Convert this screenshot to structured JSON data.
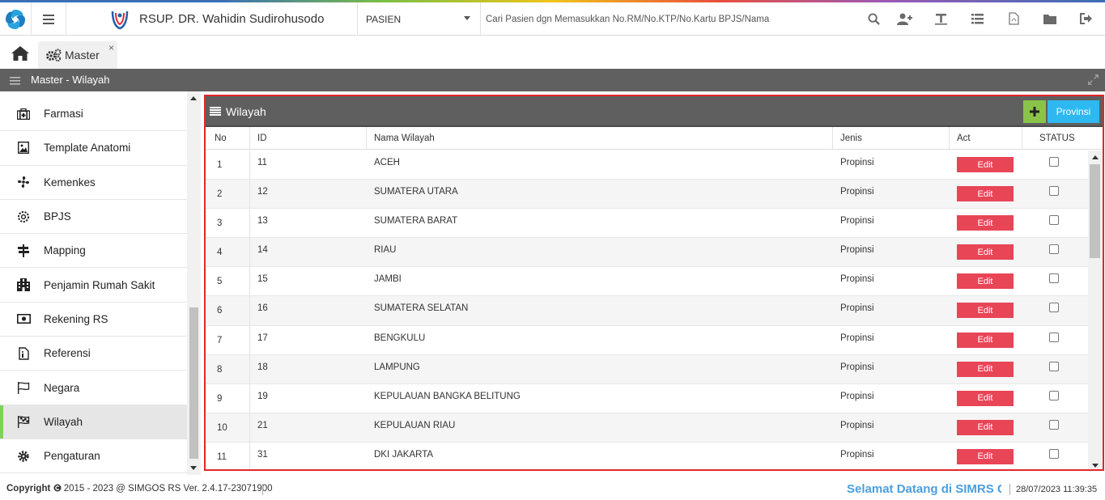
{
  "header": {
    "hospital_name": "RSUP. DR. Wahidin Sudirohusodo",
    "patient_select": "PASIEN",
    "search_placeholder": "Cari Pasien dgn Memasukkan No.RM/No.KTP/No.Kartu BPJS/Nama",
    "icons": [
      "search-icon",
      "add-user-icon",
      "text-icon",
      "list-icon",
      "pdf-icon",
      "folder-icon",
      "logout-icon"
    ]
  },
  "tabs": [
    {
      "label": "Master",
      "icon": "gears-icon",
      "close": "×"
    }
  ],
  "titlebar": {
    "title": "Master - Wilayah"
  },
  "sidebar": {
    "items": [
      {
        "label": "Farmasi",
        "icon": "medkit-icon",
        "active": false
      },
      {
        "label": "Template Anatomi",
        "icon": "image-icon",
        "active": false
      },
      {
        "label": "Kemenkes",
        "icon": "fan-icon",
        "active": false
      },
      {
        "label": "BPJS",
        "icon": "settings-icon",
        "active": false
      },
      {
        "label": "Mapping",
        "icon": "signpost-icon",
        "active": false
      },
      {
        "label": "Penjamin Rumah Sakit",
        "icon": "building-icon",
        "active": false
      },
      {
        "label": "Rekening RS",
        "icon": "money-icon",
        "active": false
      },
      {
        "label": "Referensi",
        "icon": "file-icon",
        "active": false
      },
      {
        "label": "Negara",
        "icon": "flag-icon",
        "active": false
      },
      {
        "label": "Wilayah",
        "icon": "checkered-flag-icon",
        "active": true
      },
      {
        "label": "Pengaturan",
        "icon": "gear-icon",
        "active": false
      }
    ]
  },
  "panel": {
    "title": "Wilayah",
    "add_button": "+",
    "provinsi_button": "Provinsi",
    "columns": [
      "No",
      "ID",
      "Nama Wilayah",
      "Jenis",
      "Act",
      "STATUS"
    ],
    "edit_label": "Edit",
    "rows": [
      {
        "no": "1",
        "id": "11",
        "nama": "ACEH",
        "jenis": "Propinsi"
      },
      {
        "no": "2",
        "id": "12",
        "nama": "SUMATERA UTARA",
        "jenis": "Propinsi"
      },
      {
        "no": "3",
        "id": "13",
        "nama": "SUMATERA BARAT",
        "jenis": "Propinsi"
      },
      {
        "no": "4",
        "id": "14",
        "nama": "RIAU",
        "jenis": "Propinsi"
      },
      {
        "no": "5",
        "id": "15",
        "nama": "JAMBI",
        "jenis": "Propinsi"
      },
      {
        "no": "6",
        "id": "16",
        "nama": "SUMATERA SELATAN",
        "jenis": "Propinsi"
      },
      {
        "no": "7",
        "id": "17",
        "nama": "BENGKULU",
        "jenis": "Propinsi"
      },
      {
        "no": "8",
        "id": "18",
        "nama": "LAMPUNG",
        "jenis": "Propinsi"
      },
      {
        "no": "9",
        "id": "19",
        "nama": "KEPULAUAN BANGKA BELITUNG",
        "jenis": "Propinsi"
      },
      {
        "no": "10",
        "id": "21",
        "nama": "KEPULAUAN RIAU",
        "jenis": "Propinsi"
      },
      {
        "no": "11",
        "id": "31",
        "nama": "DKI JAKARTA",
        "jenis": "Propinsi"
      }
    ]
  },
  "footer": {
    "copyright_label": "Copyright",
    "copyright_text": "2015 - 2023 @ SIMGOS RS Ver. 2.4.17-23071900",
    "welcome": "Selamat Datang di SIMRS Ga",
    "datetime": "28/07/2023 11:39:35"
  },
  "colors": {
    "titlebar": "#606060",
    "panel_border": "#e3262c",
    "edit_button": "#e84557",
    "add_button": "#8bc34a",
    "provinsi_button": "#2eb8f0",
    "active_indicator": "#7dd35a",
    "welcome_text": "#4a9fe0"
  }
}
